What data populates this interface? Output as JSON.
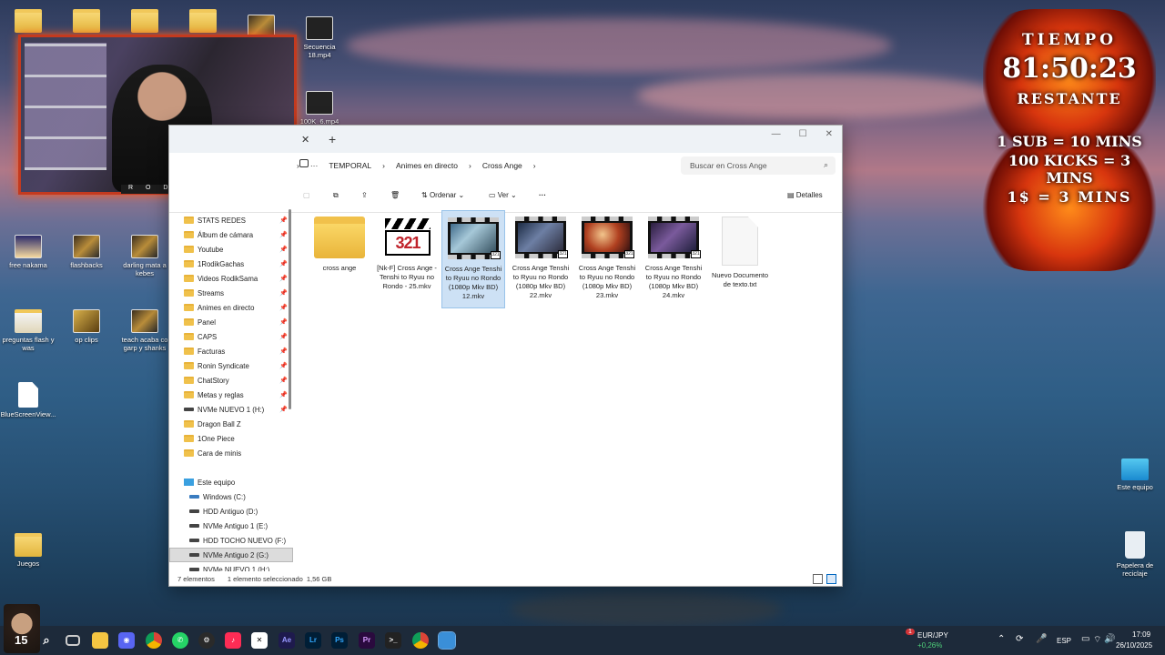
{
  "desktop": {
    "icons": [
      {
        "label": "Secuencia 18.mp4",
        "type": "video"
      },
      {
        "label": "100K_6.mp4",
        "type": "video"
      },
      {
        "label": "free nakama",
        "type": "video"
      },
      {
        "label": "flashbacks",
        "type": "video"
      },
      {
        "label": "darling mata a kebes",
        "type": "video"
      },
      {
        "label": "preguntas flash y was",
        "type": "folder"
      },
      {
        "label": "op clips",
        "type": "video"
      },
      {
        "label": "teach acaba co garp y shanks",
        "type": "video"
      },
      {
        "label": "BlueScreenView...",
        "type": "doc"
      },
      {
        "label": "Juegos",
        "type": "folder"
      },
      {
        "label": "Este equipo",
        "type": "monitor"
      },
      {
        "label": "Papelera de reciclaje",
        "type": "recycle"
      }
    ]
  },
  "webcam": {
    "label": "R O D I K"
  },
  "overlay": {
    "title": "TIEMPO",
    "time": "81:50:23",
    "restante": "RESTANTE",
    "rule1": "1 SUB = 10 MINS",
    "rule2": "100 KICKS = 3 MINS",
    "rule3": "1$ = 3 MINS"
  },
  "explorer": {
    "tab_close": "✕",
    "tab_new": "+",
    "breadcrumbs": [
      "TEMPORAL",
      "Animes en directo",
      "Cross Ange"
    ],
    "search_placeholder": "Buscar en Cross Ange",
    "toolbar": {
      "sort": "Ordenar",
      "view": "Ver",
      "more": "···",
      "details": "Detalles"
    },
    "sidebar": {
      "quick": [
        {
          "label": "STATS REDES",
          "pinned": true
        },
        {
          "label": "Álbum de cámara",
          "pinned": true
        },
        {
          "label": "Youtube",
          "pinned": true
        },
        {
          "label": "1RodikGachas",
          "pinned": true
        },
        {
          "label": "Videos RodikSama",
          "pinned": true
        },
        {
          "label": "Streams",
          "pinned": true
        },
        {
          "label": "Animes en directo",
          "pinned": true
        },
        {
          "label": "Panel",
          "pinned": true
        },
        {
          "label": "CAPS",
          "pinned": true
        },
        {
          "label": "Facturas",
          "pinned": true
        },
        {
          "label": "Ronin Syndicate",
          "pinned": true
        },
        {
          "label": "ChatStory",
          "pinned": true
        },
        {
          "label": "Metas y reglas",
          "pinned": true
        }
      ],
      "drive_quick": "NVMe NUEVO 1 (H:)",
      "more": [
        "Dragon Ball Z",
        "1One Piece",
        "Cara de minis"
      ],
      "this_pc": "Este equipo",
      "drives": [
        "Windows (C:)",
        "HDD Antiguo (D:)",
        "NVMe Antiguo 1 (E:)",
        "HDD TOCHO NUEVO (F:)",
        "NVMe Antiguo 2 (G:)",
        "NVMe NUEVO 1 (H:)"
      ],
      "selected_drive": "NVMe Antiguo 2 (G:)"
    },
    "files": [
      {
        "name": "cross ange",
        "icon": "folder"
      },
      {
        "name": "[Nk-F] Cross Ange - Tenshi to Ryuu no Rondo - 25.mkv",
        "icon": "mpc"
      },
      {
        "name": "Cross Ange Tenshi to Ryuu no Rondo (1080p Mkv BD) 12.mkv",
        "icon": "film",
        "selected": true
      },
      {
        "name": "Cross Ange Tenshi to Ryuu no Rondo (1080p Mkv BD) 22.mkv",
        "icon": "film"
      },
      {
        "name": "Cross Ange Tenshi to Ryuu no Rondo (1080p Mkv BD) 23.mkv",
        "icon": "film"
      },
      {
        "name": "Cross Ange Tenshi to Ryuu no Rondo (1080p Mkv BD) 24.mkv",
        "icon": "film"
      },
      {
        "name": "Nuevo Documento de texto.txt",
        "icon": "txt"
      }
    ],
    "status": {
      "count": "7 elementos",
      "selection": "1 elemento seleccionado",
      "size": "1,56 GB"
    }
  },
  "taskbar": {
    "apps": [
      "windows",
      "search",
      "task-view",
      "files",
      "discord",
      "chrome",
      "whatsapp",
      "steam",
      "tiktok",
      "capcut",
      "Ae",
      "Lr",
      "Ps",
      "Pr",
      "terminal",
      "chrome-2",
      "photos"
    ],
    "avatar_badge": "15",
    "ticker": {
      "symbol": "EUR/JPY",
      "change": "+0,26%",
      "badge": "1"
    },
    "lang": "ESP",
    "time": "17:09",
    "date": "26/10/2025"
  }
}
